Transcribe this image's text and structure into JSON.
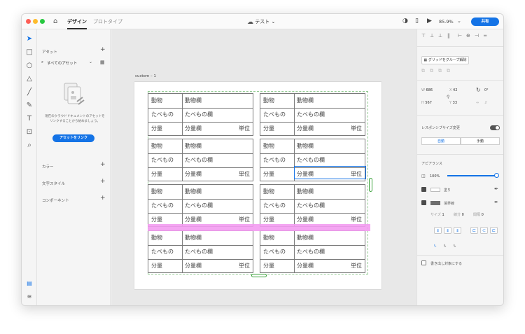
{
  "topbar": {
    "tabs": [
      "デザイン",
      "プロトタイプ"
    ],
    "document_title": "テスト",
    "zoom": "85.9%",
    "share_label": "共有"
  },
  "assets_panel": {
    "title": "アセット",
    "filter": "すべてのアセット",
    "description": [
      "現在のクラウドドキュメントのアセットを",
      "リンクすることから始めましょう。"
    ],
    "link_button": "アセットをリンク",
    "sections": [
      "カラー",
      "文字スタイル",
      "コンポーネント"
    ]
  },
  "canvas": {
    "artboard_label": "custom – 1",
    "cards": [
      {
        "rows": [
          "動物",
          "たべもの",
          "分量"
        ],
        "fields": [
          "動物欄",
          "たべもの欄",
          "分量欄"
        ],
        "unit": "単位"
      },
      {
        "rows": [
          "動物",
          "たべもの",
          "分量"
        ],
        "fields": [
          "動物欄",
          "たべもの欄",
          "分量欄"
        ],
        "unit": "単位"
      },
      {
        "rows": [
          "動物",
          "たべもの",
          "分量"
        ],
        "fields": [
          "動物欄",
          "たべもの欄",
          "分量欄"
        ],
        "unit": "単位"
      },
      {
        "rows": [
          "動物",
          "たべもの",
          "分量"
        ],
        "fields": [
          "動物欄",
          "たべもの欄",
          "分量欄"
        ],
        "unit": "単位"
      },
      {
        "rows": [
          "動物",
          "たべもの",
          "分量"
        ],
        "fields": [
          "動物欄",
          "たべもの欄",
          "分量欄"
        ],
        "unit": "単位"
      },
      {
        "rows": [
          "動物",
          "たべもの",
          "分量"
        ],
        "fields": [
          "動物欄",
          "たべもの欄",
          "分量欄"
        ],
        "unit": "単位"
      },
      {
        "rows": [
          "動物",
          "たべもの",
          "分量"
        ],
        "fields": [
          "動物欄",
          "たべもの欄",
          "分量欄"
        ],
        "unit": "単位"
      },
      {
        "rows": [
          "動物",
          "たべもの",
          "分量"
        ],
        "fields": [
          "動物欄",
          "たべもの欄",
          "分量欄"
        ],
        "unit": "単位"
      }
    ]
  },
  "inspector": {
    "ungroup_button": "グリッドをグループ解除",
    "w": "686",
    "x": "42",
    "rotation": "0°",
    "h": "567",
    "y": "33",
    "responsive_label": "レスポンシブサイズ変更",
    "auto_label": "自動",
    "manual_label": "手動",
    "appearance_label": "アピアランス",
    "opacity": "100%",
    "fill_label": "塗り",
    "border_label": "境界線",
    "size_label": "サイズ",
    "size_value": "1",
    "dash_label": "線分",
    "dash_value": "0",
    "gap_label": "間隔",
    "gap_value": "0",
    "clip_label": "書き出し対象にする"
  },
  "colors": {
    "accent": "#1473e6",
    "selection": "#8fc98f",
    "highlight": "#f39bf1"
  }
}
